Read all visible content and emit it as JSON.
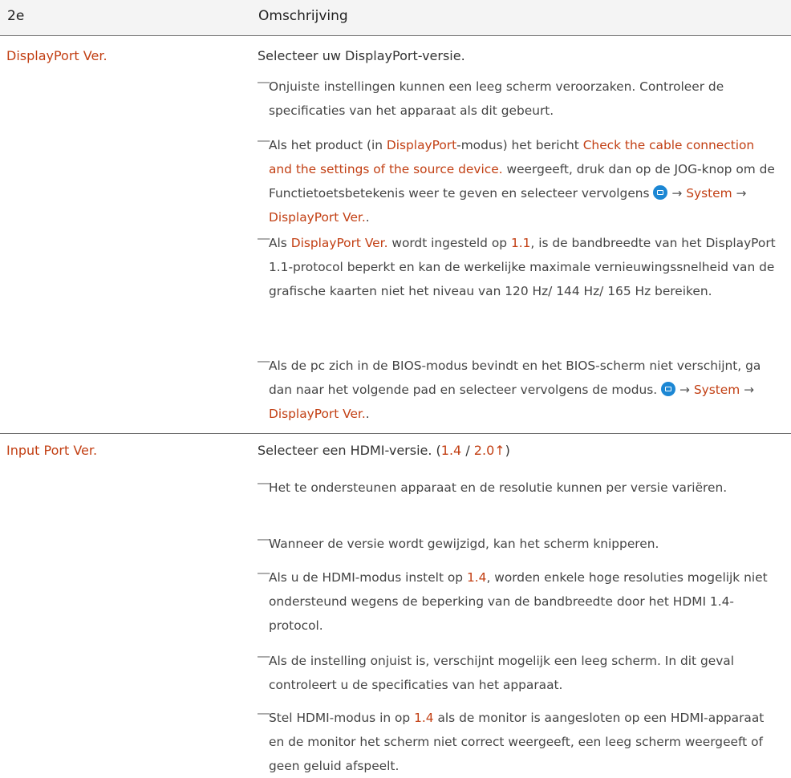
{
  "header": {
    "col1": "2e",
    "col2": "Omschrijving"
  },
  "rows": [
    {
      "label": "DisplayPort Ver.",
      "description": "Selecteer uw DisplayPort-versie.",
      "notes": {
        "n1": "Onjuiste instellingen kunnen een leeg scherm veroorzaken. Controleer de specificaties van het apparaat als dit gebeurt.",
        "n2a": "Als het product (in ",
        "n2b": "DisplayPort",
        "n2c": "-modus) het bericht ",
        "n2d": "Check the cable connection and the settings of the source device.",
        "n2e": " weergeeft, druk dan op de JOG-knop om de Functietoetsbetekenis weer te geven en selecteer vervolgens ",
        "n2f": "System",
        "n2g": "DisplayPort Ver.",
        "n3a": "Als ",
        "n3b": "DisplayPort Ver.",
        "n3c": " wordt ingesteld op ",
        "n3d": "1.1",
        "n3e": ", is de bandbreedte van het DisplayPort 1.1-protocol beperkt en kan de werkelijke maximale vernieuwingssnelheid van de grafische kaarten niet het niveau van 120 Hz/ 144 Hz/ 165 Hz bereiken.",
        "n4a": "Als de pc zich in de BIOS-modus bevindt en het BIOS-scherm niet verschijnt, ga dan naar het volgende pad en selecteer vervolgens de modus. ",
        "n4b": "System",
        "n4c": "DisplayPort Ver."
      }
    },
    {
      "label": "Input Port Ver.",
      "description_a": "Selecteer een HDMI-versie. (",
      "description_b": "1.4",
      "description_c": " / ",
      "description_d": "2.0↑",
      "description_e": ")",
      "notes": {
        "m1": "Het te ondersteunen apparaat en de resolutie kunnen per versie variëren.",
        "m2": "Wanneer de versie wordt gewijzigd, kan het scherm knipperen.",
        "m3a": "Als u de HDMI-modus instelt op ",
        "m3b": "1.4",
        "m3c": ", worden enkele hoge resoluties mogelijk niet ondersteund wegens de beperking van de bandbreedte door het HDMI 1.4-protocol.",
        "m4": "Als de instelling onjuist is, verschijnt mogelijk een leeg scherm. In dit geval controleert u de specificaties van het apparaat.",
        "m5a": "Stel HDMI-modus in op ",
        "m5b": "1.4",
        "m5c": " als de monitor is aangesloten op een HDMI-apparaat en de monitor het scherm niet correct weergeeft, een leeg scherm weergeeft of geen geluid afspeelt."
      }
    }
  ],
  "symbols": {
    "dash": "―",
    "arrow": "→",
    "menu_icon": "menu-icon",
    "dot": "."
  },
  "colors": {
    "highlight": "#c23f13",
    "icon_blue": "#1c87d4",
    "header_bg": "#f4f4f4"
  }
}
